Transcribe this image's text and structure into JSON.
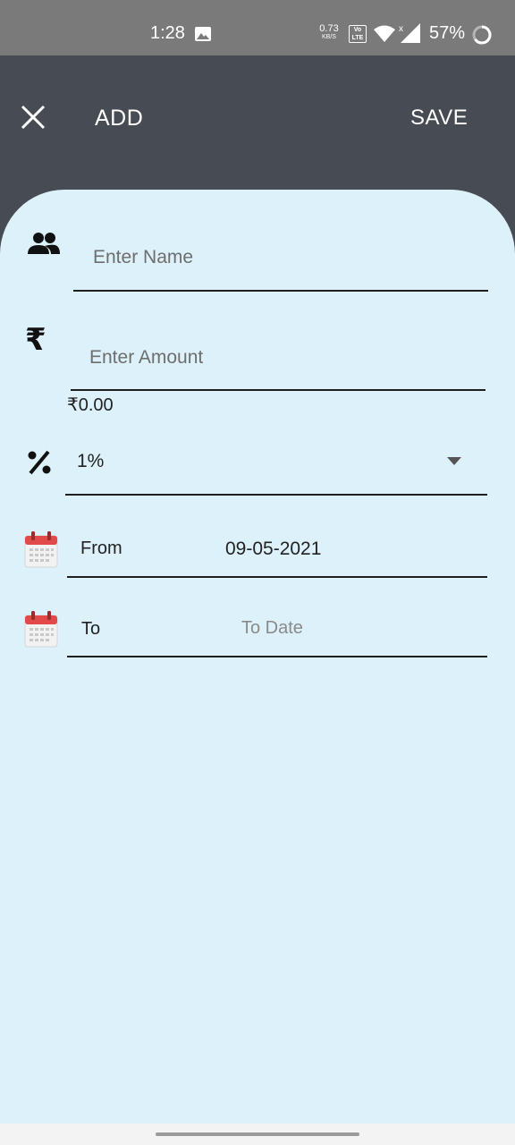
{
  "status_bar": {
    "time": "1:28",
    "network_speed": "0.73",
    "network_speed_unit": "KB/S",
    "volte": "Vo LTE",
    "battery": "57%"
  },
  "app_bar": {
    "title": "ADD",
    "save_label": "SAVE",
    "close_icon": "close-icon"
  },
  "form": {
    "name": {
      "icon": "people-icon",
      "placeholder": "Enter Name",
      "value": ""
    },
    "amount": {
      "icon": "rupee-icon",
      "placeholder": "Enter Amount",
      "value": "",
      "formatted": "₹0.00"
    },
    "interest": {
      "icon": "percent-icon",
      "selected": "1%",
      "dropdown_icon": "dropdown-arrow-icon"
    },
    "from_date": {
      "icon": "calendar-icon",
      "label": "From",
      "value": "09-05-2021"
    },
    "to_date": {
      "icon": "calendar-icon",
      "label": "To",
      "placeholder": "To Date",
      "value": ""
    }
  },
  "colors": {
    "app_bar": "#474b54",
    "sheet": "#dcf1fa",
    "status_bar": "#7a7a7a",
    "calendar_red": "#e24a4a"
  }
}
